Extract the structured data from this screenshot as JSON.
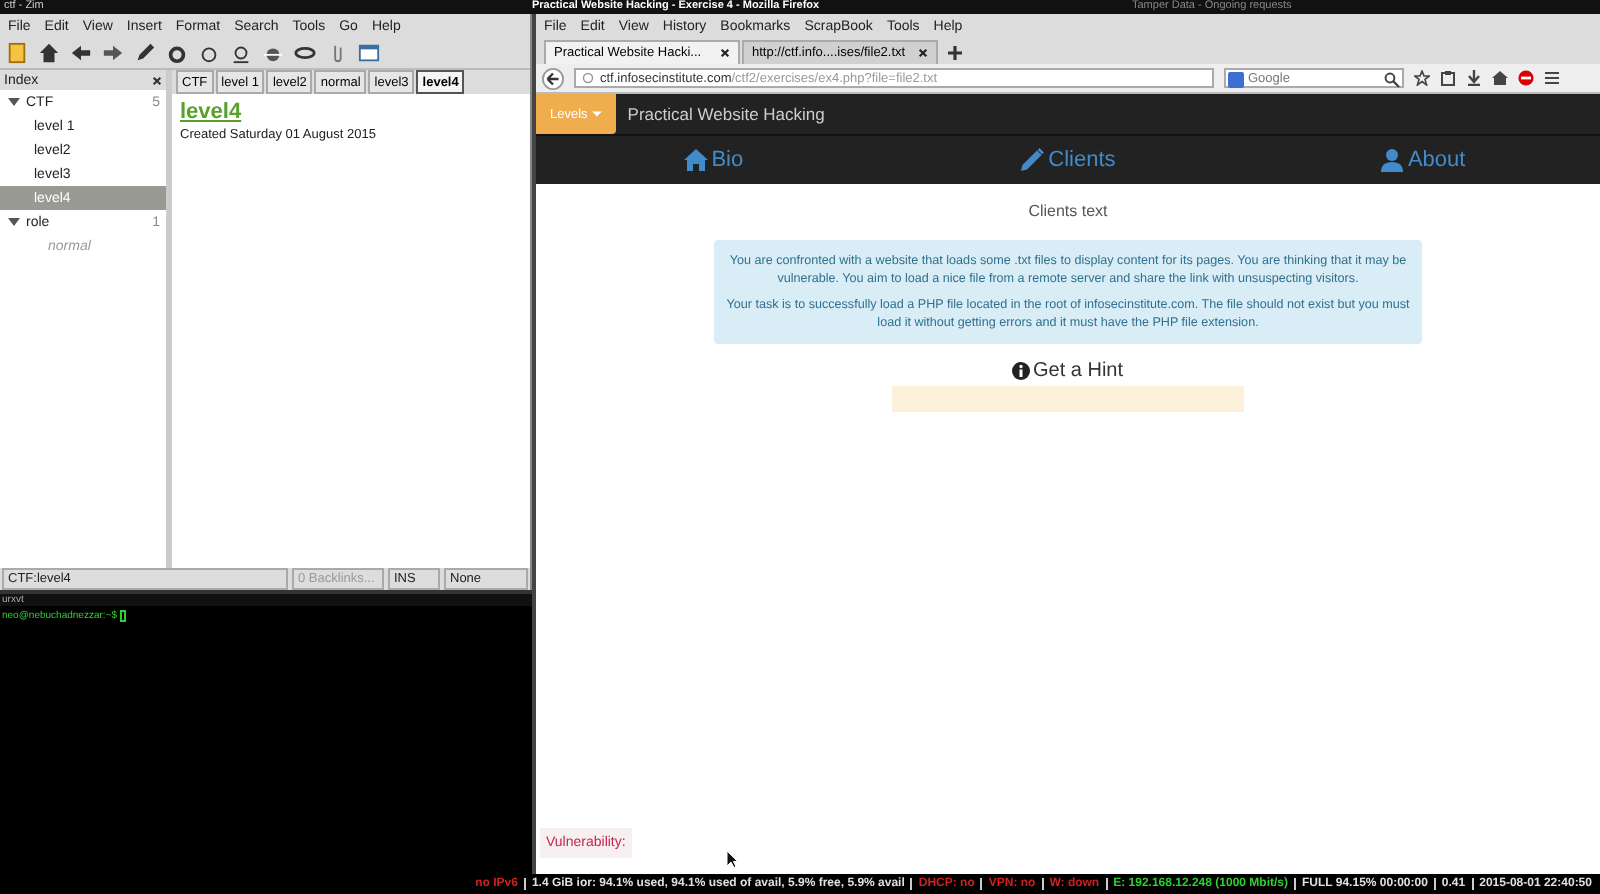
{
  "top_bar": {
    "zim_title": "ctf - Zim",
    "firefox_title": "Practical Website Hacking - Exercise 4 - Mozilla Firefox",
    "other_title": "Tamper Data - Ongoing requests"
  },
  "zim": {
    "menu": [
      "File",
      "Edit",
      "View",
      "Insert",
      "Format",
      "Search",
      "Tools",
      "Go",
      "Help"
    ],
    "index_title": "Index",
    "tree": [
      {
        "label": "CTF",
        "count": "5",
        "expanded": true,
        "children": [
          {
            "label": "level 1",
            "selected": false,
            "empty": false
          },
          {
            "label": "level2",
            "selected": false,
            "empty": false
          },
          {
            "label": "level3",
            "selected": false,
            "empty": false
          },
          {
            "label": "level4",
            "selected": true,
            "empty": false
          }
        ]
      },
      {
        "label": "role",
        "count": "1",
        "expanded": true,
        "children": [
          {
            "label": "normal",
            "selected": false,
            "empty": true
          }
        ]
      }
    ],
    "path_tabs": [
      {
        "label": "CTF",
        "selected": false
      },
      {
        "label": "level 1",
        "selected": false
      },
      {
        "label": "level2",
        "selected": false
      },
      {
        "label": "normal",
        "selected": false
      },
      {
        "label": "level3",
        "selected": false
      },
      {
        "label": "level4",
        "selected": true
      }
    ],
    "page": {
      "title": "level4",
      "created": "Created Saturday 01 August 2015"
    },
    "status": [
      "CTF:level4",
      "0 Backlinks...",
      "INS",
      "None"
    ]
  },
  "terminal": {
    "title": "urxvt",
    "prompt": "neo@nebuchadnezzar:~$"
  },
  "firefox": {
    "menu": [
      "File",
      "Edit",
      "View",
      "History",
      "Bookmarks",
      "ScrapBook",
      "Tools",
      "Help"
    ],
    "tabs": [
      {
        "label": "Practical Website Hacki...",
        "selected": true
      },
      {
        "label": "http://ctf.info....ises/file2.txt",
        "selected": false
      }
    ],
    "url": {
      "host": "ctf.infosecinstitute.com",
      "path": "/ctf2/exercises/ex4.php?file=file2.txt"
    },
    "search": {
      "placeholder": "Google"
    },
    "site": {
      "levels_button": "Levels",
      "brand": "Practical Website Hacking",
      "nav": [
        {
          "label": "Bio",
          "kind": "home"
        },
        {
          "label": "Clients",
          "kind": "pencil"
        },
        {
          "label": "About",
          "kind": "user"
        }
      ],
      "heading": "Clients text",
      "alert": [
        "You are confronted with a website that loads some .txt files to display content for its pages. You are thinking that it may be vulnerable. You aim to load a nice file from a remote server and share the link with unsuspecting visitors.",
        "Your task is to successfully load a PHP file located in the root of infosecinstitute.com. The file should not exist but you must load it without getting errors and it must have the PHP file extension."
      ],
      "hint": "Get a Hint",
      "vulnerability": "Vulnerability:"
    }
  },
  "status_bar": [
    {
      "text": "no IPv6",
      "color": "#d02020"
    },
    {
      "text": "1.4 GiB ior: 94.1% used, 94.1% used of avail, 5.9% free, 5.9% avail",
      "color": "#e0e0e0"
    },
    {
      "text": "DHCP: no",
      "color": "#d02020"
    },
    {
      "text": "VPN: no",
      "color": "#d02020"
    },
    {
      "text": "W: down",
      "color": "#d02020"
    },
    {
      "text": "E: 192.168.12.248 (1000 Mbit/s)",
      "color": "#30d030"
    },
    {
      "text": "FULL 94.15% 00:00:00",
      "color": "#e0e0e0"
    },
    {
      "text": "0.41",
      "color": "#e0e0e0"
    },
    {
      "text": "2015-08-01 22:40:50",
      "color": "#e0e0e0"
    }
  ]
}
